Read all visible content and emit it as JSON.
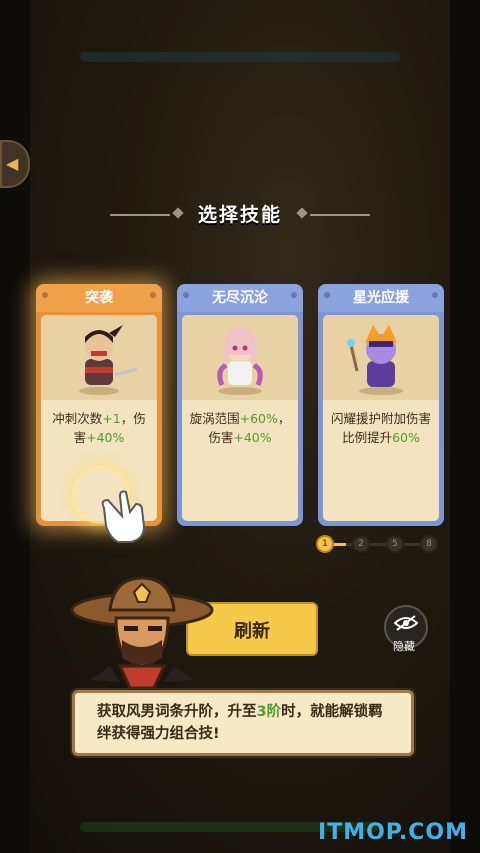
{
  "header": {
    "title": "选择技能"
  },
  "cards": [
    {
      "name": "突袭",
      "desc_a": "冲刺次数",
      "val_a": "+1",
      "desc_b": "，伤害",
      "val_b": "+40%",
      "selected": true
    },
    {
      "name": "无尽沉沦",
      "desc_a": "旋涡范围",
      "val_a": "+60%",
      "desc_b": "，伤害",
      "val_b": "+40%"
    },
    {
      "name": "星光应援",
      "desc_a": "闪耀援护附加伤害比例提升",
      "val_a": "60%",
      "desc_b": "",
      "val_b": ""
    }
  ],
  "progress": {
    "nodes": [
      "1",
      "2",
      "5",
      "8"
    ],
    "current": 1,
    "fill": 0.2
  },
  "refresh_label": "刷新",
  "hide_label": "隐藏",
  "dialog": {
    "part1": "获取风男词条升阶，升至",
    "highlight": "3阶",
    "part2": "时，就能解锁羁绊获得强力组合技!"
  },
  "watermark": "ITMOP.COM",
  "colors": {
    "accent": "#f6c94a",
    "green": "#4f9c2c",
    "card_blue": "#7d96d3",
    "card_orange": "#f0a24a"
  }
}
